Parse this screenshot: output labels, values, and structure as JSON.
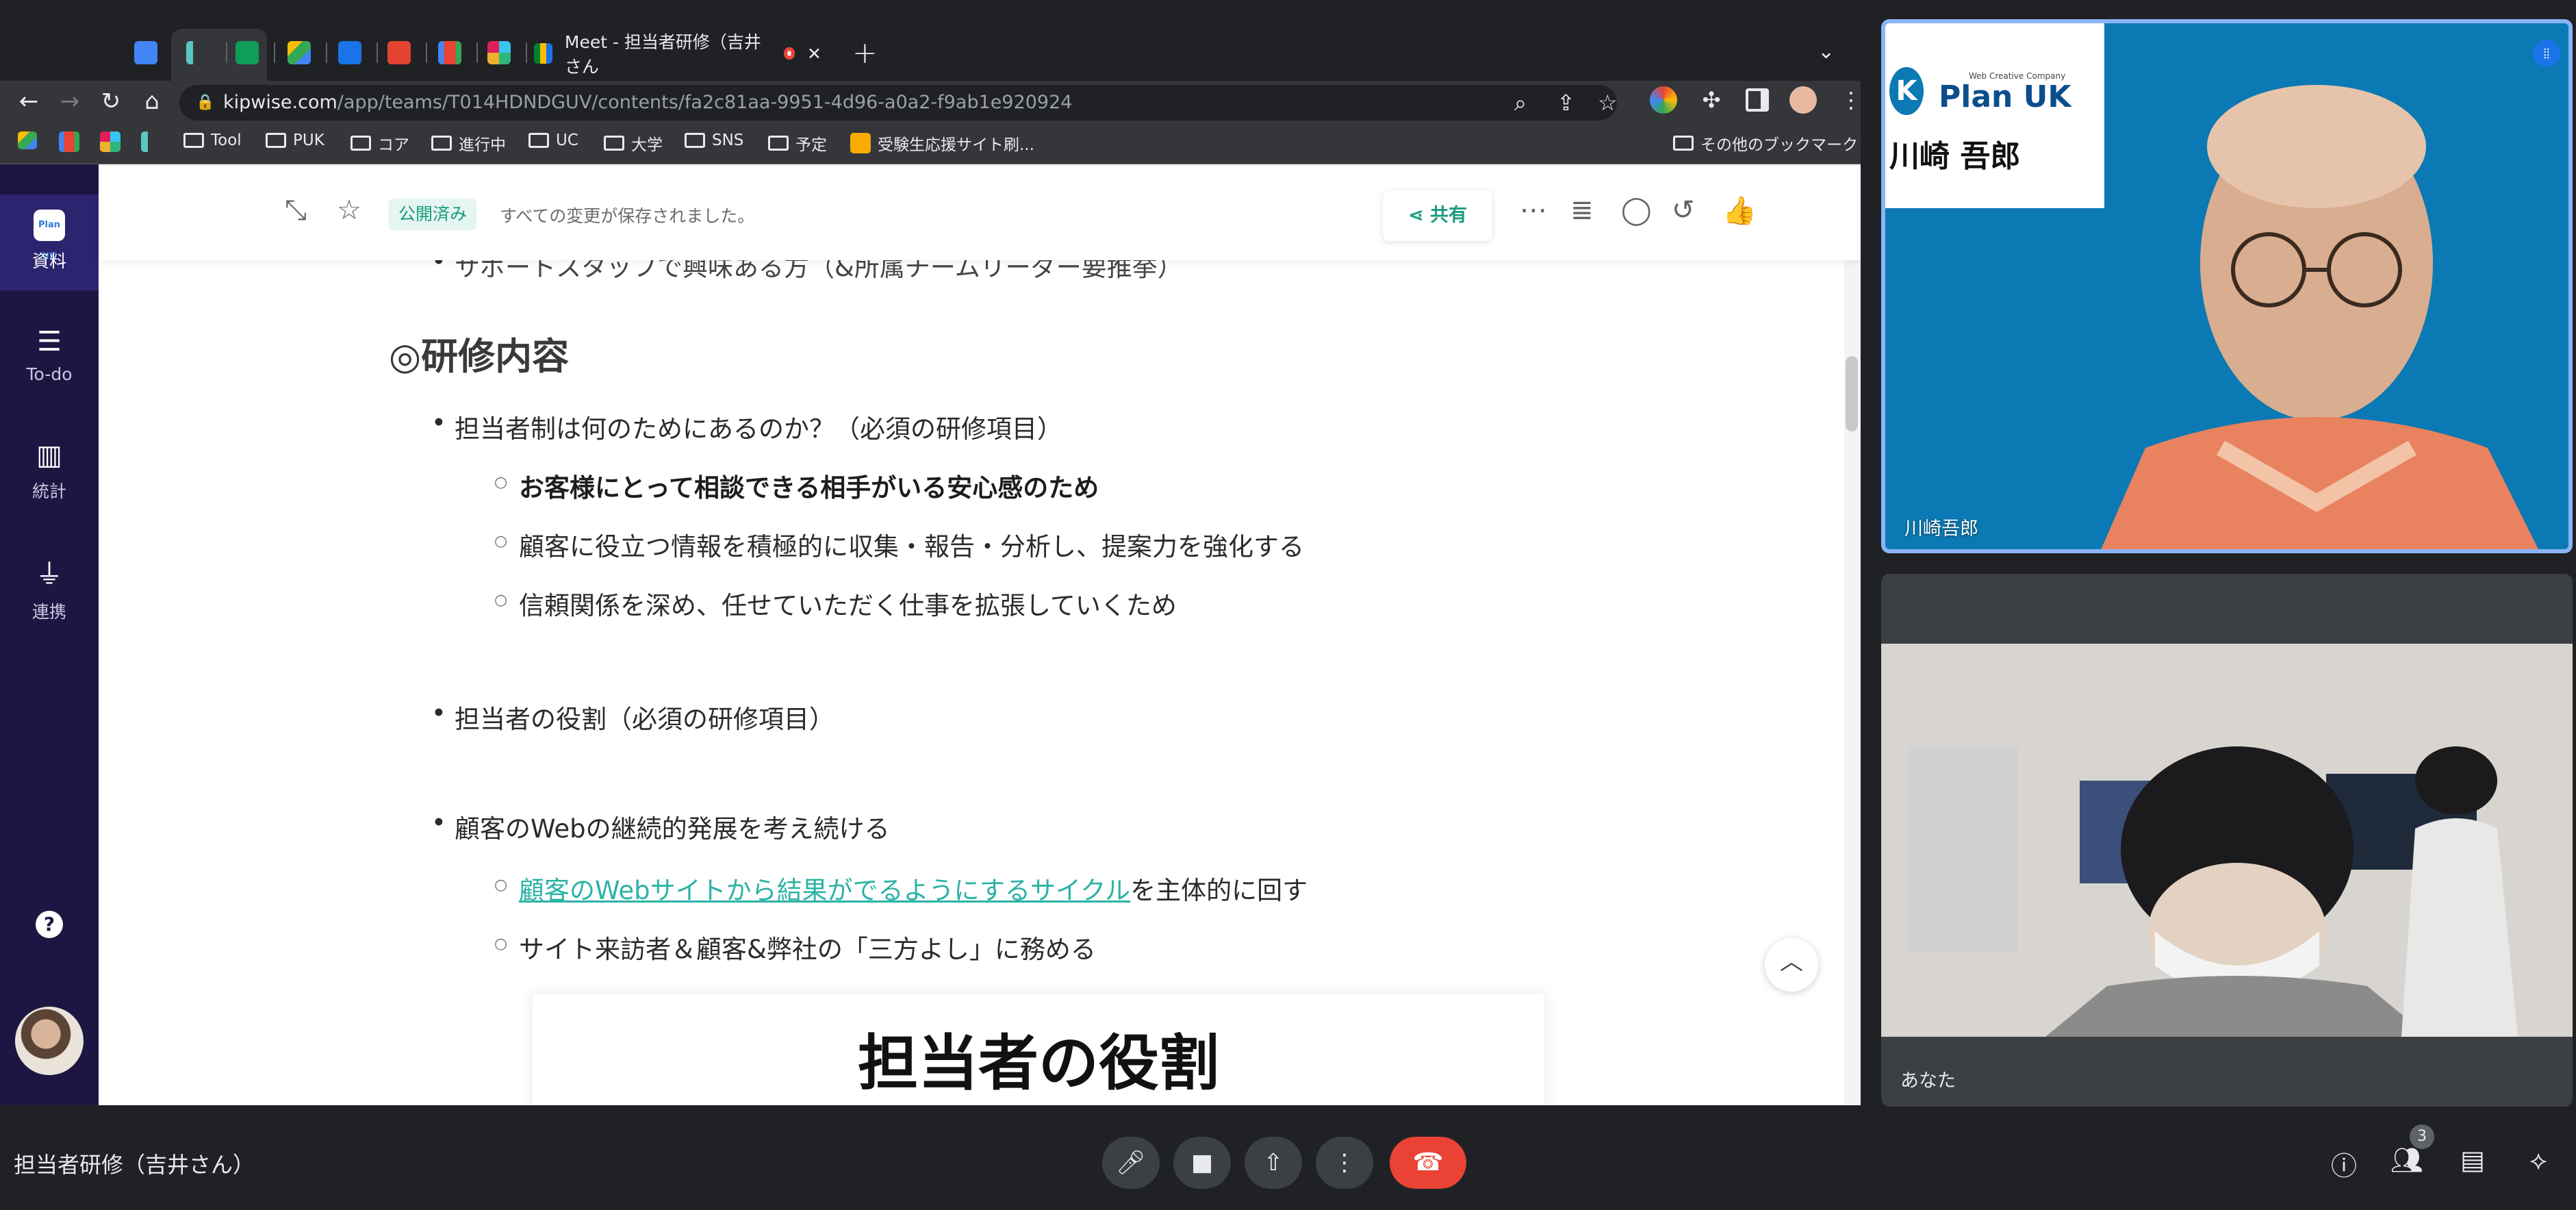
{
  "browser": {
    "meet_tab_title": "Meet - 担当者研修（吉井さん",
    "url_host": "kipwise.com",
    "url_path": "/app/teams/T014HDNDGUV/contents/fa2c81aa-9951-4d96-a0a2-f9ab1e920924",
    "new_tab_symbol": "+",
    "bookmarks": [
      "Tool",
      "PUK",
      "コア",
      "進行中",
      "UC",
      "大学",
      "SNS",
      "予定",
      "受験生応援サイト刷..."
    ],
    "other_bookmarks": "その他のブックマーク"
  },
  "sidebar": {
    "logo_text": "Plan UK",
    "items": [
      {
        "label": "資料",
        "icon": "document-icon"
      },
      {
        "label": "To-do",
        "icon": "list-icon"
      },
      {
        "label": "統計",
        "icon": "chart-icon"
      },
      {
        "label": "連携",
        "icon": "plug-icon"
      }
    ],
    "help_symbol": "?"
  },
  "doc_toolbar": {
    "publish_status": "公開済み",
    "save_status": "すべての変更が保存されました。",
    "share_label": "共有"
  },
  "document": {
    "cut_off_line": "サポートスタッフで興味ある方（&所属チームリーダー要推挙）",
    "section_heading": "◎研修内容",
    "item1": "担当者制は何のためにあるのか？（必須の研修項目）",
    "item1_sub1": "お客様にとって相談できる相手がいる安心感のため",
    "item1_sub2": "顧客に役立つ情報を積極的に収集・報告・分析し、提案力を強化する",
    "item1_sub3": "信頼関係を深め、任せていただく仕事を拡張していくため",
    "item2": "担当者の役割（必須の研修項目）",
    "item3": "顧客のWebの継続的発展を考え続ける",
    "item3_sub1_link": "顧客のWebサイトから結果がでるようにするサイクル",
    "item3_sub1_rest": "を主体的に回す",
    "item3_sub2": "サイト来訪者＆顧客&弊社の「三方よし」に務める",
    "slide_title": "担当者の役割"
  },
  "participants": [
    {
      "name": "川崎吾郎",
      "card_tagline": "Web Creative Company",
      "card_company": "Plan UK",
      "card_person": "川崎 吾郎"
    },
    {
      "name": "あなた"
    }
  ],
  "meet": {
    "meeting_title": "担当者研修（吉井さん）",
    "participant_count": "3"
  },
  "colors": {
    "sidebar_bg": "#1e1642",
    "accent_teal": "#1a9b7e",
    "link_teal": "#2bb3a5",
    "end_call_red": "#ea4335",
    "active_speaker_border": "#8ab4f8"
  }
}
